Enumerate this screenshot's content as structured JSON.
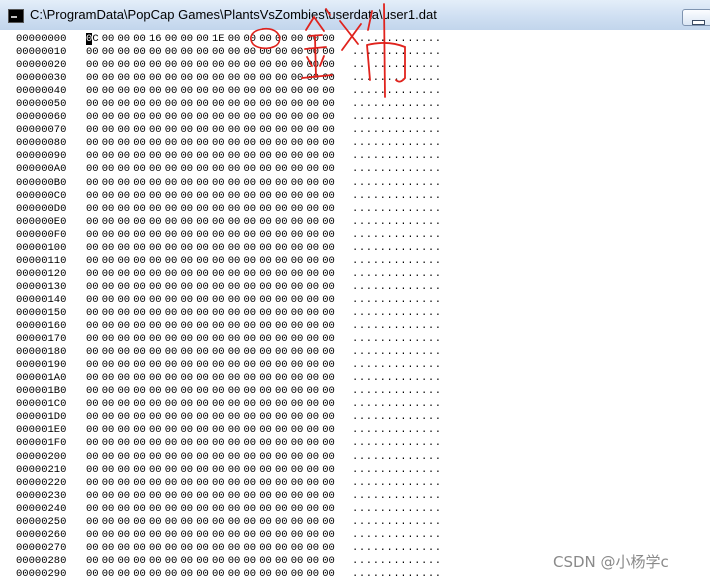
{
  "window": {
    "title": "C:\\ProgramData\\PopCap Games\\PlantsVsZombies\\userdata\\user1.dat",
    "icon": "console-icon",
    "minimize_icon": "minimize-icon"
  },
  "hexdump": {
    "rows": [
      {
        "addr": "00000000",
        "bytes": [
          "0C",
          "00",
          "00",
          "00",
          "16",
          "00",
          "00",
          "00",
          "1E",
          "00",
          "00",
          "00",
          "00",
          "00",
          "00",
          "00"
        ],
        "ascii": "............."
      },
      {
        "addr": "00000010",
        "bytes": [
          "00",
          "00",
          "00",
          "00",
          "00",
          "00",
          "00",
          "00",
          "00",
          "00",
          "00",
          "00",
          "00",
          "00",
          "00",
          "00"
        ],
        "ascii": "............."
      },
      {
        "addr": "00000020",
        "bytes": [
          "00",
          "00",
          "00",
          "00",
          "00",
          "00",
          "00",
          "00",
          "00",
          "00",
          "00",
          "00",
          "00",
          "00",
          "00",
          "00"
        ],
        "ascii": "............."
      },
      {
        "addr": "00000030",
        "bytes": [
          "00",
          "00",
          "00",
          "00",
          "00",
          "00",
          "00",
          "00",
          "00",
          "00",
          "00",
          "00",
          "00",
          "00",
          "00",
          "00"
        ],
        "ascii": "............."
      },
      {
        "addr": "00000040",
        "bytes": [
          "00",
          "00",
          "00",
          "00",
          "00",
          "00",
          "00",
          "00",
          "00",
          "00",
          "00",
          "00",
          "00",
          "00",
          "00",
          "00"
        ],
        "ascii": "............."
      },
      {
        "addr": "00000050",
        "bytes": [
          "00",
          "00",
          "00",
          "00",
          "00",
          "00",
          "00",
          "00",
          "00",
          "00",
          "00",
          "00",
          "00",
          "00",
          "00",
          "00"
        ],
        "ascii": "............."
      },
      {
        "addr": "00000060",
        "bytes": [
          "00",
          "00",
          "00",
          "00",
          "00",
          "00",
          "00",
          "00",
          "00",
          "00",
          "00",
          "00",
          "00",
          "00",
          "00",
          "00"
        ],
        "ascii": "............."
      },
      {
        "addr": "00000070",
        "bytes": [
          "00",
          "00",
          "00",
          "00",
          "00",
          "00",
          "00",
          "00",
          "00",
          "00",
          "00",
          "00",
          "00",
          "00",
          "00",
          "00"
        ],
        "ascii": "............."
      },
      {
        "addr": "00000080",
        "bytes": [
          "00",
          "00",
          "00",
          "00",
          "00",
          "00",
          "00",
          "00",
          "00",
          "00",
          "00",
          "00",
          "00",
          "00",
          "00",
          "00"
        ],
        "ascii": "............."
      },
      {
        "addr": "00000090",
        "bytes": [
          "00",
          "00",
          "00",
          "00",
          "00",
          "00",
          "00",
          "00",
          "00",
          "00",
          "00",
          "00",
          "00",
          "00",
          "00",
          "00"
        ],
        "ascii": "............."
      },
      {
        "addr": "000000A0",
        "bytes": [
          "00",
          "00",
          "00",
          "00",
          "00",
          "00",
          "00",
          "00",
          "00",
          "00",
          "00",
          "00",
          "00",
          "00",
          "00",
          "00"
        ],
        "ascii": "............."
      },
      {
        "addr": "000000B0",
        "bytes": [
          "00",
          "00",
          "00",
          "00",
          "00",
          "00",
          "00",
          "00",
          "00",
          "00",
          "00",
          "00",
          "00",
          "00",
          "00",
          "00"
        ],
        "ascii": "............."
      },
      {
        "addr": "000000C0",
        "bytes": [
          "00",
          "00",
          "00",
          "00",
          "00",
          "00",
          "00",
          "00",
          "00",
          "00",
          "00",
          "00",
          "00",
          "00",
          "00",
          "00"
        ],
        "ascii": "............."
      },
      {
        "addr": "000000D0",
        "bytes": [
          "00",
          "00",
          "00",
          "00",
          "00",
          "00",
          "00",
          "00",
          "00",
          "00",
          "00",
          "00",
          "00",
          "00",
          "00",
          "00"
        ],
        "ascii": "............."
      },
      {
        "addr": "000000E0",
        "bytes": [
          "00",
          "00",
          "00",
          "00",
          "00",
          "00",
          "00",
          "00",
          "00",
          "00",
          "00",
          "00",
          "00",
          "00",
          "00",
          "00"
        ],
        "ascii": "............."
      },
      {
        "addr": "000000F0",
        "bytes": [
          "00",
          "00",
          "00",
          "00",
          "00",
          "00",
          "00",
          "00",
          "00",
          "00",
          "00",
          "00",
          "00",
          "00",
          "00",
          "00"
        ],
        "ascii": "............."
      },
      {
        "addr": "00000100",
        "bytes": [
          "00",
          "00",
          "00",
          "00",
          "00",
          "00",
          "00",
          "00",
          "00",
          "00",
          "00",
          "00",
          "00",
          "00",
          "00",
          "00"
        ],
        "ascii": "............."
      },
      {
        "addr": "00000110",
        "bytes": [
          "00",
          "00",
          "00",
          "00",
          "00",
          "00",
          "00",
          "00",
          "00",
          "00",
          "00",
          "00",
          "00",
          "00",
          "00",
          "00"
        ],
        "ascii": "............."
      },
      {
        "addr": "00000120",
        "bytes": [
          "00",
          "00",
          "00",
          "00",
          "00",
          "00",
          "00",
          "00",
          "00",
          "00",
          "00",
          "00",
          "00",
          "00",
          "00",
          "00"
        ],
        "ascii": "............."
      },
      {
        "addr": "00000130",
        "bytes": [
          "00",
          "00",
          "00",
          "00",
          "00",
          "00",
          "00",
          "00",
          "00",
          "00",
          "00",
          "00",
          "00",
          "00",
          "00",
          "00"
        ],
        "ascii": "............."
      },
      {
        "addr": "00000140",
        "bytes": [
          "00",
          "00",
          "00",
          "00",
          "00",
          "00",
          "00",
          "00",
          "00",
          "00",
          "00",
          "00",
          "00",
          "00",
          "00",
          "00"
        ],
        "ascii": "............."
      },
      {
        "addr": "00000150",
        "bytes": [
          "00",
          "00",
          "00",
          "00",
          "00",
          "00",
          "00",
          "00",
          "00",
          "00",
          "00",
          "00",
          "00",
          "00",
          "00",
          "00"
        ],
        "ascii": "............."
      },
      {
        "addr": "00000160",
        "bytes": [
          "00",
          "00",
          "00",
          "00",
          "00",
          "00",
          "00",
          "00",
          "00",
          "00",
          "00",
          "00",
          "00",
          "00",
          "00",
          "00"
        ],
        "ascii": "............."
      },
      {
        "addr": "00000170",
        "bytes": [
          "00",
          "00",
          "00",
          "00",
          "00",
          "00",
          "00",
          "00",
          "00",
          "00",
          "00",
          "00",
          "00",
          "00",
          "00",
          "00"
        ],
        "ascii": "............."
      },
      {
        "addr": "00000180",
        "bytes": [
          "00",
          "00",
          "00",
          "00",
          "00",
          "00",
          "00",
          "00",
          "00",
          "00",
          "00",
          "00",
          "00",
          "00",
          "00",
          "00"
        ],
        "ascii": "............."
      },
      {
        "addr": "00000190",
        "bytes": [
          "00",
          "00",
          "00",
          "00",
          "00",
          "00",
          "00",
          "00",
          "00",
          "00",
          "00",
          "00",
          "00",
          "00",
          "00",
          "00"
        ],
        "ascii": "............."
      },
      {
        "addr": "000001A0",
        "bytes": [
          "00",
          "00",
          "00",
          "00",
          "00",
          "00",
          "00",
          "00",
          "00",
          "00",
          "00",
          "00",
          "00",
          "00",
          "00",
          "00"
        ],
        "ascii": "............."
      },
      {
        "addr": "000001B0",
        "bytes": [
          "00",
          "00",
          "00",
          "00",
          "00",
          "00",
          "00",
          "00",
          "00",
          "00",
          "00",
          "00",
          "00",
          "00",
          "00",
          "00"
        ],
        "ascii": "............."
      },
      {
        "addr": "000001C0",
        "bytes": [
          "00",
          "00",
          "00",
          "00",
          "00",
          "00",
          "00",
          "00",
          "00",
          "00",
          "00",
          "00",
          "00",
          "00",
          "00",
          "00"
        ],
        "ascii": "............."
      },
      {
        "addr": "000001D0",
        "bytes": [
          "00",
          "00",
          "00",
          "00",
          "00",
          "00",
          "00",
          "00",
          "00",
          "00",
          "00",
          "00",
          "00",
          "00",
          "00",
          "00"
        ],
        "ascii": "............."
      },
      {
        "addr": "000001E0",
        "bytes": [
          "00",
          "00",
          "00",
          "00",
          "00",
          "00",
          "00",
          "00",
          "00",
          "00",
          "00",
          "00",
          "00",
          "00",
          "00",
          "00"
        ],
        "ascii": "............."
      },
      {
        "addr": "000001F0",
        "bytes": [
          "00",
          "00",
          "00",
          "00",
          "00",
          "00",
          "00",
          "00",
          "00",
          "00",
          "00",
          "00",
          "00",
          "00",
          "00",
          "00"
        ],
        "ascii": "............."
      },
      {
        "addr": "00000200",
        "bytes": [
          "00",
          "00",
          "00",
          "00",
          "00",
          "00",
          "00",
          "00",
          "00",
          "00",
          "00",
          "00",
          "00",
          "00",
          "00",
          "00"
        ],
        "ascii": "............."
      },
      {
        "addr": "00000210",
        "bytes": [
          "00",
          "00",
          "00",
          "00",
          "00",
          "00",
          "00",
          "00",
          "00",
          "00",
          "00",
          "00",
          "00",
          "00",
          "00",
          "00"
        ],
        "ascii": "............."
      },
      {
        "addr": "00000220",
        "bytes": [
          "00",
          "00",
          "00",
          "00",
          "00",
          "00",
          "00",
          "00",
          "00",
          "00",
          "00",
          "00",
          "00",
          "00",
          "00",
          "00"
        ],
        "ascii": "............."
      },
      {
        "addr": "00000230",
        "bytes": [
          "00",
          "00",
          "00",
          "00",
          "00",
          "00",
          "00",
          "00",
          "00",
          "00",
          "00",
          "00",
          "00",
          "00",
          "00",
          "00"
        ],
        "ascii": "............."
      },
      {
        "addr": "00000240",
        "bytes": [
          "00",
          "00",
          "00",
          "00",
          "00",
          "00",
          "00",
          "00",
          "00",
          "00",
          "00",
          "00",
          "00",
          "00",
          "00",
          "00"
        ],
        "ascii": "............."
      },
      {
        "addr": "00000250",
        "bytes": [
          "00",
          "00",
          "00",
          "00",
          "00",
          "00",
          "00",
          "00",
          "00",
          "00",
          "00",
          "00",
          "00",
          "00",
          "00",
          "00"
        ],
        "ascii": "............."
      },
      {
        "addr": "00000260",
        "bytes": [
          "00",
          "00",
          "00",
          "00",
          "00",
          "00",
          "00",
          "00",
          "00",
          "00",
          "00",
          "00",
          "00",
          "00",
          "00",
          "00"
        ],
        "ascii": "............."
      },
      {
        "addr": "00000270",
        "bytes": [
          "00",
          "00",
          "00",
          "00",
          "00",
          "00",
          "00",
          "00",
          "00",
          "00",
          "00",
          "00",
          "00",
          "00",
          "00",
          "00"
        ],
        "ascii": "............."
      },
      {
        "addr": "00000280",
        "bytes": [
          "00",
          "00",
          "00",
          "00",
          "00",
          "00",
          "00",
          "00",
          "00",
          "00",
          "00",
          "00",
          "00",
          "00",
          "00",
          "00"
        ],
        "ascii": "............."
      },
      {
        "addr": "00000290",
        "bytes": [
          "00",
          "00",
          "00",
          "00",
          "00",
          "00",
          "00",
          "00",
          "00",
          "00",
          "00",
          "00",
          "00",
          "00",
          "00",
          "00"
        ],
        "ascii": "............."
      }
    ]
  },
  "annotation": {
    "ink_color": "#e0231d",
    "handwriting": "金币"
  },
  "watermark": {
    "text": "CSDN @小杨学c"
  }
}
